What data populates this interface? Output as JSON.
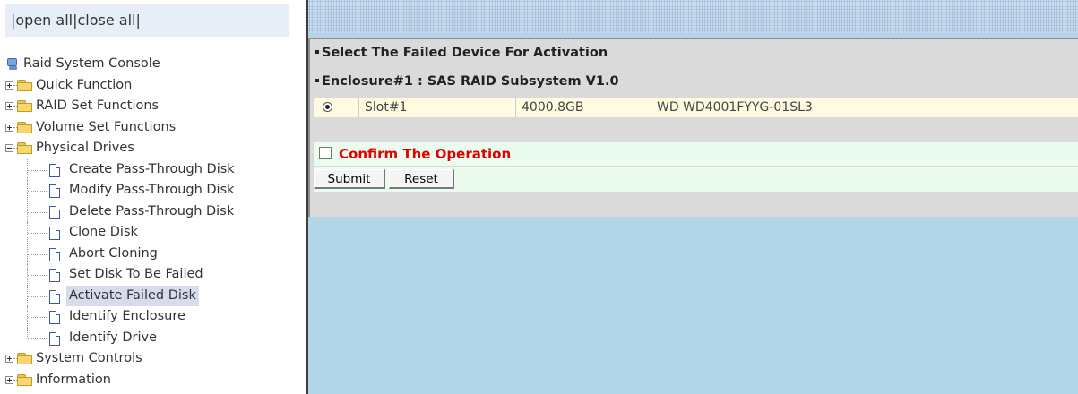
{
  "top_links": {
    "prefix": "|",
    "open_all": "open all",
    "sep": "|",
    "close_all": "close all",
    "suffix": "|"
  },
  "tree": {
    "root": "Raid System Console",
    "items": [
      {
        "label": "Quick Function"
      },
      {
        "label": "RAID Set Functions"
      },
      {
        "label": "Volume Set Functions"
      },
      {
        "label": "Physical Drives"
      },
      {
        "label": "System Controls"
      },
      {
        "label": "Information"
      }
    ],
    "physical_drives_children": [
      {
        "label": "Create Pass-Through Disk"
      },
      {
        "label": "Modify Pass-Through Disk"
      },
      {
        "label": "Delete Pass-Through Disk"
      },
      {
        "label": "Clone Disk"
      },
      {
        "label": "Abort Cloning"
      },
      {
        "label": "Set Disk To Be Failed"
      },
      {
        "label": "Activate Failed Disk"
      },
      {
        "label": "Identify Enclosure"
      },
      {
        "label": "Identify Drive"
      }
    ],
    "selected": "Activate Failed Disk"
  },
  "main": {
    "section_title": "Select The Failed Device For Activation",
    "enclosure_title": "Enclosure#1 : SAS RAID Subsystem V1.0",
    "device_row": {
      "slot": "Slot#1",
      "capacity": "4000.8GB",
      "model": "WD WD4001FYYG-01SL3",
      "selected": true
    },
    "confirm_label": "Confirm The Operation",
    "confirm_checked": false,
    "submit_label": "Submit",
    "reset_label": "Reset"
  },
  "colors": {
    "confirm_text": "#e00000",
    "row_highlight": "#fffbe1",
    "confirm_bg": "#ebfcee",
    "right_bg": "#b2d5e8"
  }
}
